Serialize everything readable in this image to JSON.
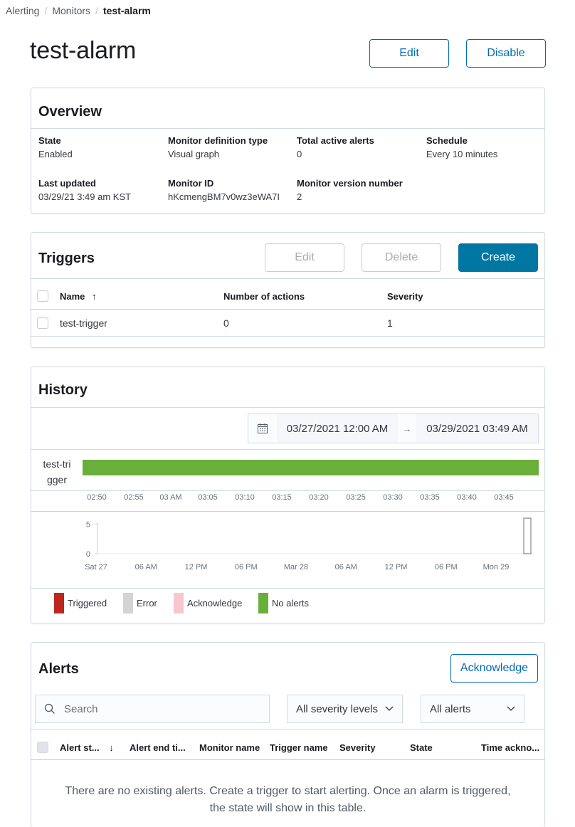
{
  "breadcrumb": {
    "items": [
      "Alerting",
      "Monitors"
    ],
    "current": "test-alarm"
  },
  "header": {
    "title": "test-alarm",
    "edit_label": "Edit",
    "disable_label": "Disable"
  },
  "overview": {
    "title": "Overview",
    "fields": [
      {
        "label": "State",
        "value": "Enabled"
      },
      {
        "label": "Monitor definition type",
        "value": "Visual graph"
      },
      {
        "label": "Total active alerts",
        "value": "0"
      },
      {
        "label": "Schedule",
        "value": "Every 10 minutes"
      },
      {
        "label": "Last updated",
        "value": "03/29/21 3:49 am KST"
      },
      {
        "label": "Monitor ID",
        "value": "hKcmengBM7v0wz3eWA7I"
      },
      {
        "label": "Monitor version number",
        "value": "2"
      }
    ]
  },
  "triggers": {
    "title": "Triggers",
    "edit_label": "Edit",
    "delete_label": "Delete",
    "create_label": "Create",
    "columns": [
      "Name",
      "Number of actions",
      "Severity"
    ],
    "rows": [
      {
        "name": "test-trigger",
        "actions": "0",
        "severity": "1"
      }
    ]
  },
  "history": {
    "title": "History",
    "date_start": "03/27/2021 12:00 AM",
    "date_end": "03/29/2021 03:49 AM",
    "arrow": "→",
    "trigger_label_line1": "test-tri",
    "trigger_label_line2": "gger",
    "timeline_ticks": [
      "02:50",
      "02:55",
      "03 AM",
      "03:05",
      "03:10",
      "03:15",
      "03:20",
      "03:25",
      "03:30",
      "03:35",
      "03:40",
      "03:45"
    ],
    "legend": [
      {
        "label": "Triggered",
        "color": "#bd271e"
      },
      {
        "label": "Error",
        "color": "#d3d3d3"
      },
      {
        "label": "Acknowledge",
        "color": "#f9c6d0"
      },
      {
        "label": "No alerts",
        "color": "#6aae3b"
      }
    ]
  },
  "chart_data": {
    "type": "bar",
    "x_tick_labels": [
      "Sat 27",
      "06 AM",
      "12 PM",
      "06 PM",
      "Mar 28",
      "06 AM",
      "12 PM",
      "06 PM",
      "Mon 29"
    ],
    "y_tick_labels": [
      "0",
      "5"
    ],
    "ylim": [
      0,
      6
    ],
    "bars": [
      {
        "x": "03/29/2021 03:40",
        "value": 6
      }
    ],
    "grid": false
  },
  "alerts": {
    "title": "Alerts",
    "acknowledge_label": "Acknowledge",
    "search_placeholder": "Search",
    "severity_select": "All severity levels",
    "state_select": "All alerts",
    "columns": [
      "Alert st...",
      "Alert end ti...",
      "Monitor name",
      "Trigger name",
      "Severity",
      "State",
      "Time ackno..."
    ],
    "empty_message": "There are no existing alerts. Create a trigger to start alerting. Once an alarm is triggered, the state will show in this table."
  },
  "colors": {
    "accent": "#006bb8",
    "primary": "#0077a3",
    "no_alerts": "#6aae3b"
  }
}
